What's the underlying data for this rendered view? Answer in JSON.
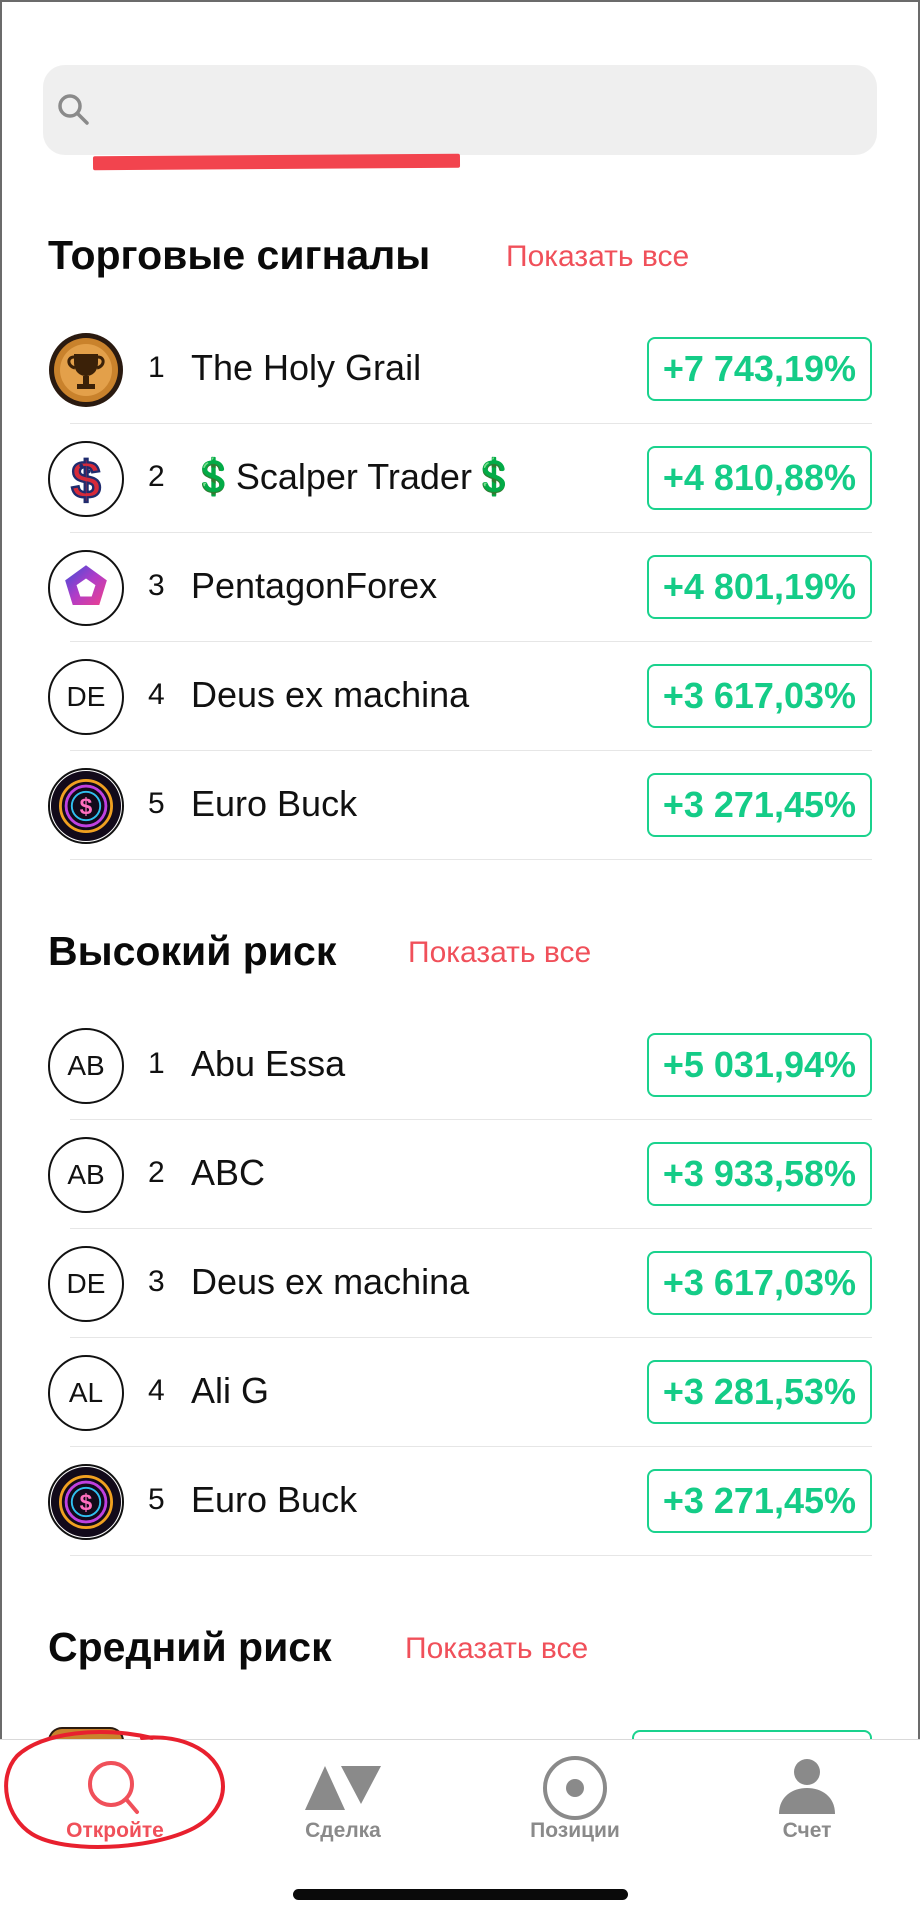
{
  "search": {
    "placeholder": "",
    "value": ""
  },
  "colors": {
    "accent": "#f0505a",
    "gain": "#14cc87",
    "gain_border": "#1ad28d",
    "search_bg": "#efefef"
  },
  "sections": [
    {
      "title": "Торговые сигналы",
      "show_all": "Показать все",
      "items": [
        {
          "rank": "1",
          "name": "The Holy Grail",
          "value": "+7 743,19%",
          "avatar_type": "image",
          "avatar_icon": "trophy-icon"
        },
        {
          "rank": "2",
          "name": "💲Scalper Trader💲",
          "value": "+4 810,88%",
          "avatar_type": "image",
          "avatar_icon": "dollar-icon"
        },
        {
          "rank": "3",
          "name": "PentagonForex",
          "value": "+4 801,19%",
          "avatar_type": "image",
          "avatar_icon": "pentagon-icon"
        },
        {
          "rank": "4",
          "name": "Deus ex machina",
          "value": "+3 617,03%",
          "avatar_type": "initials",
          "initials": "DE"
        },
        {
          "rank": "5",
          "name": "Euro Buck",
          "value": "+3 271,45%",
          "avatar_type": "image",
          "avatar_icon": "neon-coin-icon"
        }
      ]
    },
    {
      "title": "Высокий риск",
      "show_all": "Показать все",
      "items": [
        {
          "rank": "1",
          "name": "Abu Essa",
          "value": "+5 031,94%",
          "avatar_type": "initials",
          "initials": "AB"
        },
        {
          "rank": "2",
          "name": "ABC",
          "value": "+3 933,58%",
          "avatar_type": "initials",
          "initials": "AB"
        },
        {
          "rank": "3",
          "name": "Deus ex machina",
          "value": "+3 617,03%",
          "avatar_type": "initials",
          "initials": "DE"
        },
        {
          "rank": "4",
          "name": "Ali G",
          "value": "+3 281,53%",
          "avatar_type": "initials",
          "initials": "AL"
        },
        {
          "rank": "5",
          "name": "Euro Buck",
          "value": "+3 271,45%",
          "avatar_type": "image",
          "avatar_icon": "neon-coin-icon"
        }
      ]
    },
    {
      "title": "Средний риск",
      "show_all": "Показать все",
      "items": []
    }
  ],
  "tabs": [
    {
      "label": "Откройте",
      "icon": "search-icon",
      "active": true
    },
    {
      "label": "Сделка",
      "icon": "trade-triangles-icon",
      "active": false
    },
    {
      "label": "Позиции",
      "icon": "positions-target-icon",
      "active": false
    },
    {
      "label": "Счет",
      "icon": "person-icon",
      "active": false
    }
  ]
}
